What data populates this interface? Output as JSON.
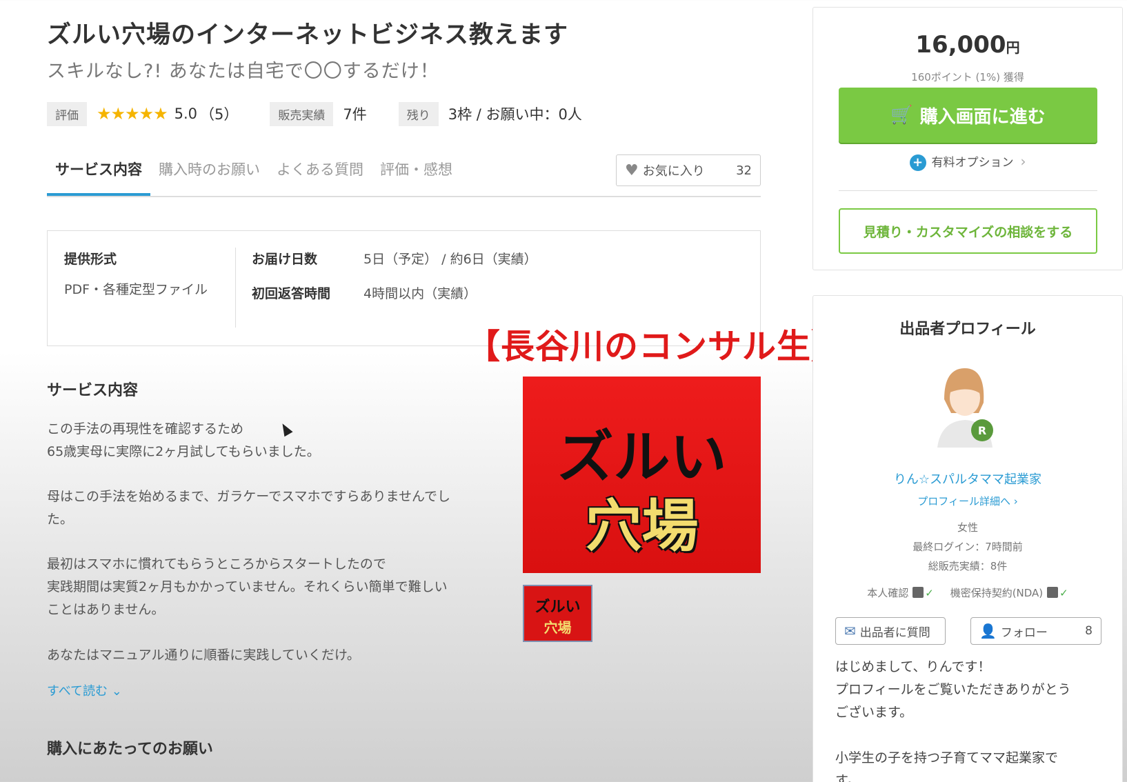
{
  "header": {
    "title": "ズルい穴場のインターネットビジネス教えます",
    "subtitle": "スキルなし?! あなたは自宅で〇〇するだけ！"
  },
  "stats": {
    "rating_label": "評価",
    "stars": "★★★★★",
    "rating": "5.0",
    "rating_count": "（5）",
    "sales_label": "販売実績",
    "sales": "7件",
    "remaining_label": "残り",
    "remaining": "3枠 / お願い中：0人"
  },
  "tabs": [
    "サービス内容",
    "購入時のお願い",
    "よくある質問",
    "評価・感想"
  ],
  "favorite": {
    "label": "お気に入り",
    "count": "32"
  },
  "info": {
    "format_label": "提供形式",
    "format_value": "PDF・各種定型ファイル",
    "delivery_label": "お届け日数",
    "delivery_value": "5日（予定） / 約6日（実績）",
    "response_label": "初回返答時間",
    "response_value": "4時間以内（実績）"
  },
  "overlay_text": "【長谷川のコンサル生】",
  "service": {
    "heading": "サービス内容",
    "p1_l1": "この手法の再現性を確認するため",
    "p1_l2": "65歳実母に実際に2ヶ月試してもらいました。",
    "p2_l1": "母はこの手法を始めるまで、ガラケーでスマホですらありませんでし",
    "p2_l2": "た。",
    "p3_l1": "最初はスマホに慣れてもらうところからスタートしたので",
    "p3_l2": "実践期間は実質2ヶ月もかかっていません。それくらい簡単で難しい",
    "p3_l3": "ことはありません。",
    "p4_l1": "あなたはマニュアル通りに順番に実践していくだけ。",
    "read_more": "すべて読む ⌄"
  },
  "thumbnail": {
    "line1": "ズルい",
    "line2": "穴場"
  },
  "notes_heading": "購入にあたってのお願い",
  "purchase": {
    "price": "16,000",
    "currency": "円",
    "points": "160ポイント (1%) 獲得",
    "buy_label": "購入画面に進む",
    "options_label": "有料オプション",
    "consult_label": "見積り・カスタマイズの相談をする"
  },
  "profile": {
    "heading": "出品者プロフィール",
    "name": "りん☆スパルタママ起業家",
    "detail_link": "プロフィール詳細へ ›",
    "gender": "女性",
    "last_login": "最終ログイン：7時間前",
    "total_sales": "総販売実績：8件",
    "identity_label": "本人確認",
    "nda_label": "機密保持契約(NDA)",
    "ask_label": "出品者に質問",
    "follow_label": "フォロー",
    "follow_count": "8",
    "intro_l1": "はじめまして、りんです！",
    "intro_l2": "プロフィールをご覧いただきありがとう",
    "intro_l3": "ございます。",
    "intro_l4": "小学生の子を持つ子育てママ起業家で",
    "intro_l5": "す。"
  },
  "colors": {
    "accent_blue": "#2a9bd3",
    "buy_green": "#7ac943",
    "overlay_red": "#e01a1a",
    "star": "#f5b400"
  }
}
